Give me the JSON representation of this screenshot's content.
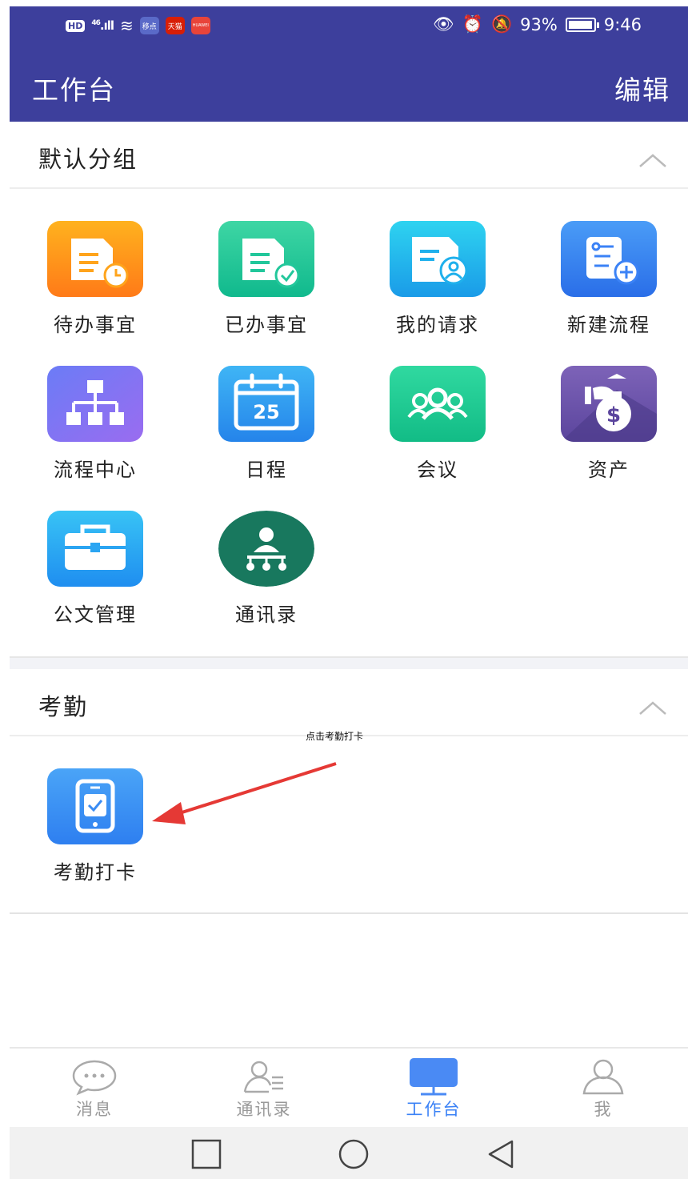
{
  "status_bar": {
    "left_badge": "HD",
    "network": "46",
    "apps": [
      "移点",
      "天猫",
      "HUAWEI"
    ],
    "battery": "93%",
    "time": "9:46"
  },
  "header": {
    "title": "工作台",
    "edit_label": "编辑"
  },
  "sections": [
    {
      "title": "默认分组",
      "items": [
        {
          "label": "待办事宜",
          "icon": "pending-tasks-icon"
        },
        {
          "label": "已办事宜",
          "icon": "done-tasks-icon"
        },
        {
          "label": "我的请求",
          "icon": "my-requests-icon"
        },
        {
          "label": "新建流程",
          "icon": "new-process-icon"
        },
        {
          "label": "流程中心",
          "icon": "process-center-icon"
        },
        {
          "label": "日程",
          "icon": "calendar-icon",
          "day": "25"
        },
        {
          "label": "会议",
          "icon": "meeting-icon"
        },
        {
          "label": "资产",
          "icon": "assets-icon",
          "symbol": "$"
        },
        {
          "label": "公文管理",
          "icon": "document-management-icon"
        },
        {
          "label": "通讯录",
          "icon": "contacts-org-icon"
        }
      ]
    },
    {
      "title": "考勤",
      "items": [
        {
          "label": "考勤打卡",
          "icon": "attendance-checkin-icon"
        }
      ]
    }
  ],
  "annotation": {
    "text": "点击考勤打卡",
    "arrow_color": "#e53935"
  },
  "tabbar": {
    "tabs": [
      {
        "label": "消息",
        "icon": "message-icon",
        "active": false
      },
      {
        "label": "通讯录",
        "icon": "contacts-icon",
        "active": false
      },
      {
        "label": "工作台",
        "icon": "workbench-icon",
        "active": true
      },
      {
        "label": "我",
        "icon": "profile-icon",
        "active": false
      }
    ]
  },
  "nav_buttons": [
    "recent-apps-icon",
    "home-icon",
    "back-icon"
  ],
  "colors": {
    "header_bg": "#3d3f9c",
    "active_tab": "#3b82f6",
    "inactive_tab": "#999999"
  }
}
